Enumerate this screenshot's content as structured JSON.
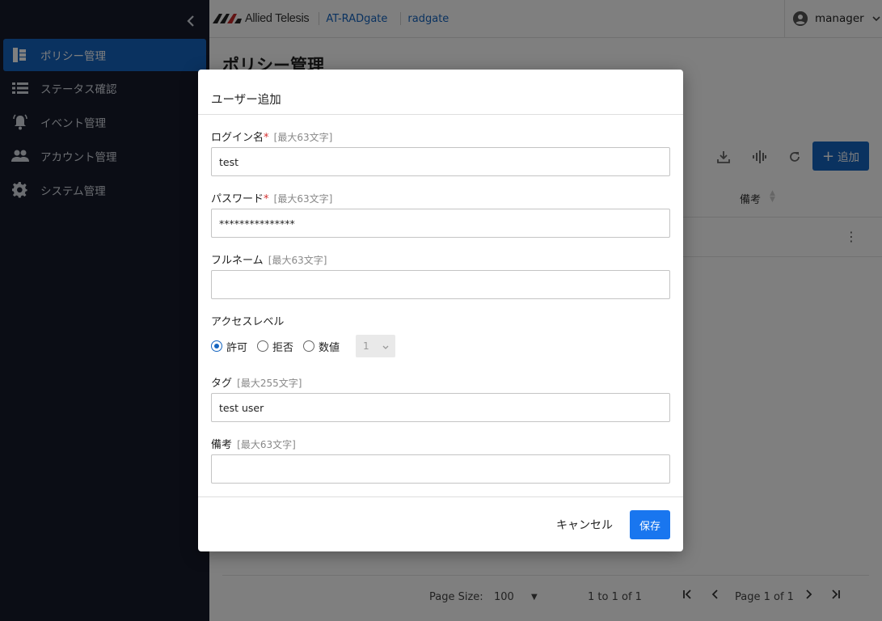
{
  "sidebar": {
    "items": [
      {
        "label": "ポリシー管理",
        "icon": "policy-tree-icon"
      },
      {
        "label": "ステータス確認",
        "icon": "list-icon"
      },
      {
        "label": "イベント管理",
        "icon": "bell-icon"
      },
      {
        "label": "アカウント管理",
        "icon": "people-icon"
      },
      {
        "label": "システム管理",
        "icon": "gear-icon"
      }
    ]
  },
  "header": {
    "brand": "Allied Telesis",
    "product": "AT-RADgate",
    "host": "radgate",
    "user": "manager"
  },
  "main": {
    "title": "ポリシー管理",
    "add_label": "追加",
    "column_note": "備考",
    "footer": {
      "page_size_label": "Page Size:",
      "page_size_value": "100",
      "range_text": "1 to 1 of 1",
      "page_text": "Page 1 of 1"
    }
  },
  "modal": {
    "title": "ユーザー追加",
    "login": {
      "label": "ログイン名",
      "required": "*",
      "hint": "[最大63文字]",
      "value": "test"
    },
    "password": {
      "label": "パスワード",
      "required": "*",
      "hint": "[最大63文字]",
      "value": "***************"
    },
    "fullname": {
      "label": "フルネーム",
      "hint": "[最大63文字]",
      "value": ""
    },
    "access": {
      "label": "アクセスレベル",
      "options": [
        "許可",
        "拒否",
        "数値"
      ],
      "selected": "許可",
      "level_value": "1"
    },
    "tag": {
      "label": "タグ",
      "hint": "[最大255文字]",
      "value": "test user"
    },
    "note": {
      "label": "備考",
      "hint": "[最大63文字]",
      "value": ""
    },
    "cancel_label": "キャンセル",
    "save_label": "保存"
  },
  "colors": {
    "accent": "#1565c0",
    "save": "#1976ef",
    "sidebar_bg": "#161b2b"
  }
}
